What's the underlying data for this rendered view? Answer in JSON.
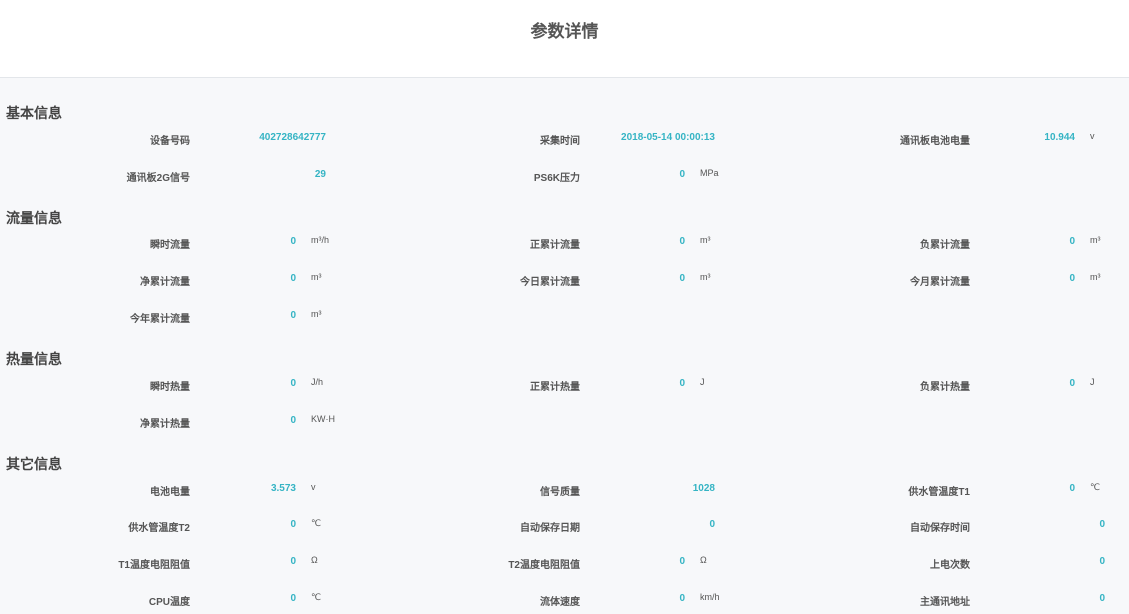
{
  "page_title": "参数详情",
  "sections": [
    {
      "title": "基本信息",
      "fields": [
        {
          "label": "设备号码",
          "value": "402728642777",
          "unit": ""
        },
        {
          "label": "采集时间",
          "value": "2018-05-14 00:00:13",
          "unit": ""
        },
        {
          "label": "通讯板电池电量",
          "value": "10.944",
          "unit": "v"
        },
        {
          "label": "通讯板2G信号",
          "value": "29",
          "unit": ""
        },
        {
          "label": "PS6K压力",
          "value": "0",
          "unit": "MPa"
        }
      ]
    },
    {
      "title": "流量信息",
      "fields": [
        {
          "label": "瞬时流量",
          "value": "0",
          "unit": "m³/h"
        },
        {
          "label": "正累计流量",
          "value": "0",
          "unit": "m³"
        },
        {
          "label": "负累计流量",
          "value": "0",
          "unit": "m³"
        },
        {
          "label": "净累计流量",
          "value": "0",
          "unit": "m³"
        },
        {
          "label": "今日累计流量",
          "value": "0",
          "unit": "m³"
        },
        {
          "label": "今月累计流量",
          "value": "0",
          "unit": "m³"
        },
        {
          "label": "今年累计流量",
          "value": "0",
          "unit": "m³"
        }
      ]
    },
    {
      "title": "热量信息",
      "fields": [
        {
          "label": "瞬时热量",
          "value": "0",
          "unit": "J/h"
        },
        {
          "label": "正累计热量",
          "value": "0",
          "unit": "J"
        },
        {
          "label": "负累计热量",
          "value": "0",
          "unit": "J"
        },
        {
          "label": "净累计热量",
          "value": "0",
          "unit": "KW·H"
        }
      ]
    },
    {
      "title": "其它信息",
      "fields": [
        {
          "label": "电池电量",
          "value": "3.573",
          "unit": "v"
        },
        {
          "label": "信号质量",
          "value": "1028",
          "unit": ""
        },
        {
          "label": "供水管温度T1",
          "value": "0",
          "unit": "℃"
        },
        {
          "label": "供水管温度T2",
          "value": "0",
          "unit": "℃"
        },
        {
          "label": "自动保存日期",
          "value": "0",
          "unit": ""
        },
        {
          "label": "自动保存时间",
          "value": "0",
          "unit": ""
        },
        {
          "label": "T1温度电阻阻值",
          "value": "0",
          "unit": "Ω"
        },
        {
          "label": "T2温度电阻阻值",
          "value": "0",
          "unit": "Ω"
        },
        {
          "label": "上电次数",
          "value": "0",
          "unit": ""
        },
        {
          "label": "CPU温度",
          "value": "0",
          "unit": "℃"
        },
        {
          "label": "流体速度",
          "value": "0",
          "unit": "km/h"
        },
        {
          "label": "主通讯地址",
          "value": "0",
          "unit": ""
        }
      ]
    }
  ]
}
